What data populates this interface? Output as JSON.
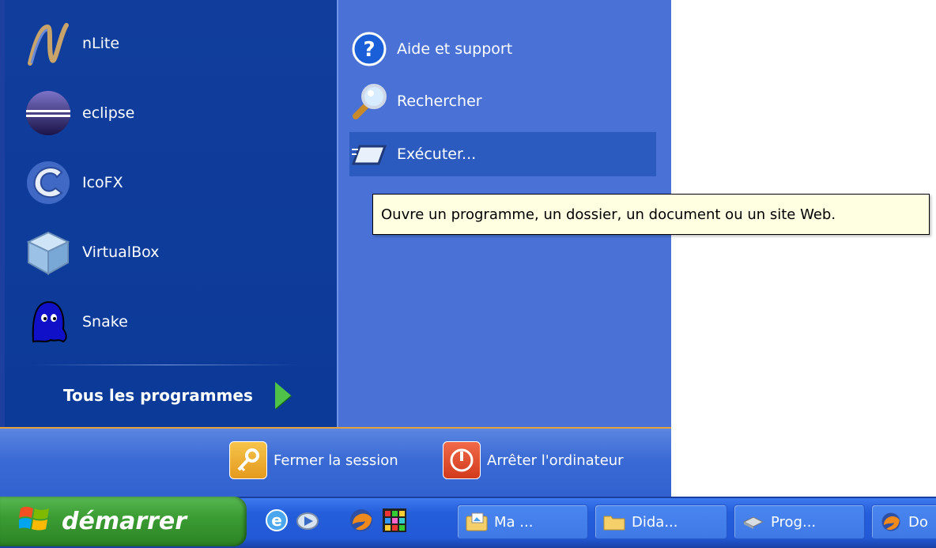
{
  "left_programs": [
    {
      "label": "nLite",
      "icon": "nlite-icon"
    },
    {
      "label": "eclipse",
      "icon": "eclipse-icon"
    },
    {
      "label": "IcoFX",
      "icon": "icofx-icon"
    },
    {
      "label": "VirtualBox",
      "icon": "virtualbox-icon"
    },
    {
      "label": "Snake",
      "icon": "snake-icon"
    }
  ],
  "all_programs_label": "Tous les programmes",
  "right_items": [
    {
      "label": "Aide et support",
      "icon": "help-icon"
    },
    {
      "label": "Rechercher",
      "icon": "search-icon"
    },
    {
      "label": "Exécuter...",
      "icon": "run-icon"
    }
  ],
  "tooltip": "Ouvre un programme, un dossier, un document ou un site Web.",
  "bottom": {
    "logoff_label": "Fermer la session",
    "shutdown_label": "Arrêter l'ordinateur"
  },
  "taskbar": {
    "start_label": "démarrer",
    "tasks": [
      {
        "label": "Ma ...",
        "icon": "folder-pictures-icon"
      },
      {
        "label": "Dida...",
        "icon": "folder-icon"
      },
      {
        "label": "Prog...",
        "icon": "drive-icon"
      },
      {
        "label": "Do",
        "icon": "firefox-icon"
      }
    ]
  },
  "colors": {
    "left_panel": "#0c3a98",
    "right_panel": "#4a72d6",
    "start_button": "#3c9d34",
    "taskbar": "#245edb",
    "tooltip_bg": "#ffffe1"
  }
}
